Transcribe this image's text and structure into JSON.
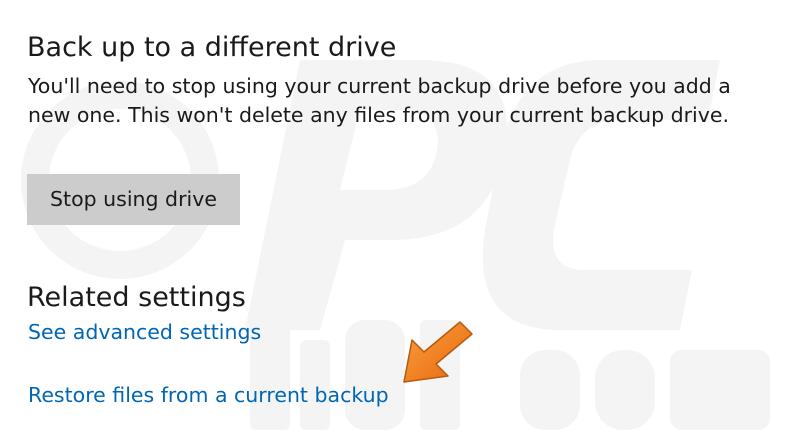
{
  "backup_section": {
    "title": "Back up to a different drive",
    "description": "You'll need to stop using your current backup drive before you add a new one. This won't delete any files from your current backup drive.",
    "stop_button_label": "Stop using drive"
  },
  "related_settings": {
    "title": "Related settings",
    "links": [
      {
        "label": "See advanced settings"
      },
      {
        "label": "Restore files from a current backup"
      }
    ]
  },
  "colors": {
    "link": "#0066b4",
    "button_bg": "#cccccc",
    "arrow": "#f07f1a",
    "watermark": "#f2f2f2"
  },
  "icons": {
    "annotation_arrow": "arrow-pointing-down-left-icon"
  }
}
